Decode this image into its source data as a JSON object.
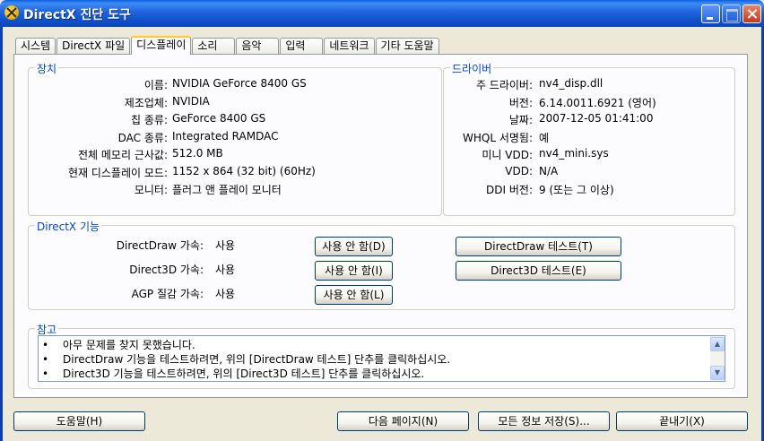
{
  "window": {
    "title": "DirectX 진단 도구",
    "icon": "directx-icon"
  },
  "tabs": [
    {
      "label": "시스템",
      "active": false
    },
    {
      "label": "DirectX 파일",
      "active": false
    },
    {
      "label": "디스플레이",
      "active": true
    },
    {
      "label": "소리",
      "active": false
    },
    {
      "label": "음악",
      "active": false
    },
    {
      "label": "입력",
      "active": false
    },
    {
      "label": "네트워크",
      "active": false
    },
    {
      "label": "기타 도움말",
      "active": false
    }
  ],
  "device": {
    "title": "장치",
    "rows": [
      {
        "label": "이름:",
        "value": "NVIDIA GeForce 8400 GS"
      },
      {
        "label": "제조업체:",
        "value": "NVIDIA"
      },
      {
        "label": "칩 종류:",
        "value": "GeForce 8400 GS"
      },
      {
        "label": "DAC 종류:",
        "value": "Integrated RAMDAC"
      },
      {
        "label": "전체 메모리 근사값:",
        "value": "512.0 MB"
      },
      {
        "label": "현재 디스플레이 모드:",
        "value": "1152 x 864 (32 bit) (60Hz)"
      },
      {
        "label": "모니터:",
        "value": "플러그 앤 플레이 모니터"
      }
    ]
  },
  "driver": {
    "title": "드라이버",
    "rows": [
      {
        "label": "주 드라이버:",
        "value": "nv4_disp.dll"
      },
      {
        "label": "버전:",
        "value": "6.14.0011.6921 (영어)"
      },
      {
        "label": "날짜:",
        "value": "2007-12-05 01:41:00"
      },
      {
        "label": "WHQL 서명됨:",
        "value": "예"
      },
      {
        "label": "미니 VDD:",
        "value": "nv4_mini.sys"
      },
      {
        "label": "VDD:",
        "value": "N/A"
      },
      {
        "label": "DDI 버전:",
        "value": "9 (또는 그 이상)"
      }
    ]
  },
  "features": {
    "title": "DirectX 기능",
    "rows": [
      {
        "label": "DirectDraw 가속:",
        "value": "사용",
        "disable_button": "사용 안 함(D)",
        "test_button": "DirectDraw 테스트(T)"
      },
      {
        "label": "Direct3D 가속:",
        "value": "사용",
        "disable_button": "사용 안 함(I)",
        "test_button": "Direct3D 테스트(E)"
      },
      {
        "label": "AGP 질감 가속:",
        "value": "사용",
        "disable_button": "사용 안 함(L)",
        "test_button": ""
      }
    ]
  },
  "notes": {
    "title": "참고",
    "bullet": "•",
    "items": [
      "아무 문제를 찾지 못했습니다.",
      "DirectDraw 기능을 테스트하려면, 위의 [DirectDraw 테스트] 단추를 클릭하십시오.",
      "Direct3D 기능을 테스트하려면, 위의 [Direct3D 테스트] 단추를 클릭하십시오."
    ],
    "scroll_up": "▲",
    "scroll_down": "▼"
  },
  "footer": {
    "help": "도움말(H)",
    "next_page": "다음 페이지(N)",
    "save_all": "모든 정보 저장(S)...",
    "exit": "끝내기(X)"
  }
}
